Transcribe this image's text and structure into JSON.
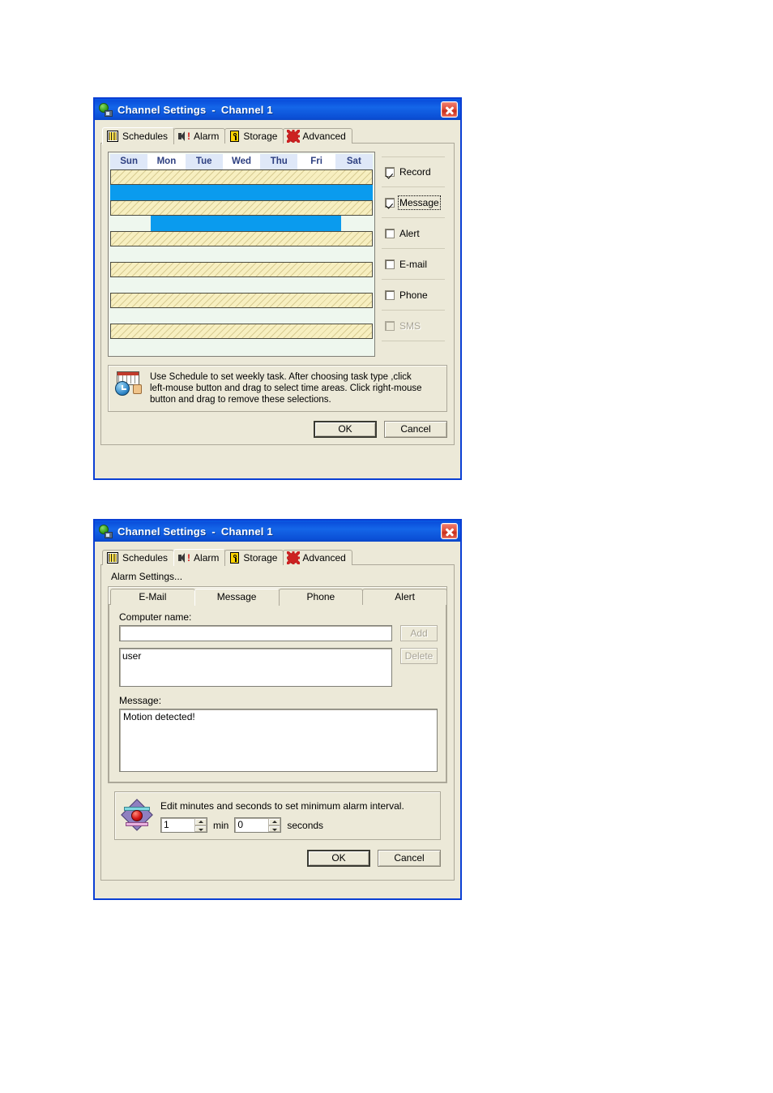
{
  "dialog1": {
    "title_app": "Channel Settings",
    "title_sep": "-",
    "title_channel": "Channel 1",
    "close_icon": "close-icon",
    "tabs": [
      {
        "label": "Schedules",
        "icon": "grid-icon",
        "active": true
      },
      {
        "label": "Alarm",
        "icon": "alarm-icon",
        "active": false
      },
      {
        "label": "Storage",
        "icon": "storage-icon",
        "active": false
      },
      {
        "label": "Advanced",
        "icon": "gear-icon",
        "active": false
      }
    ],
    "schedule": {
      "days": [
        "Sun",
        "Mon",
        "Tue",
        "Wed",
        "Thu",
        "Fri",
        "Sat"
      ],
      "rows": [
        {
          "type": "task",
          "selection": null
        },
        {
          "type": "empty",
          "selection": {
            "start_pct": 0,
            "width_pct": 100
          }
        },
        {
          "type": "task",
          "selection": null
        },
        {
          "type": "empty",
          "selection": {
            "start_pct": 15.5,
            "width_pct": 72.5
          }
        },
        {
          "type": "task",
          "selection": null
        },
        {
          "type": "empty",
          "selection": null
        },
        {
          "type": "task",
          "selection": null
        },
        {
          "type": "empty",
          "selection": null
        },
        {
          "type": "task",
          "selection": null
        },
        {
          "type": "empty",
          "selection": null
        },
        {
          "type": "task",
          "selection": null
        },
        {
          "type": "empty",
          "selection": null
        }
      ],
      "selection_color": "#0a9bee",
      "task_color": "#f7efc0",
      "empty_color": "#eef7ee"
    },
    "options": [
      {
        "label": "Record",
        "checked": true,
        "disabled": false,
        "focused": false
      },
      {
        "label": "Message",
        "checked": true,
        "disabled": false,
        "focused": true
      },
      {
        "label": "Alert",
        "checked": false,
        "disabled": false,
        "focused": false
      },
      {
        "label": "E-mail",
        "checked": false,
        "disabled": false,
        "focused": false
      },
      {
        "label": "Phone",
        "checked": false,
        "disabled": false,
        "focused": false
      },
      {
        "label": "SMS",
        "checked": false,
        "disabled": true,
        "focused": false
      }
    ],
    "hint": {
      "icon": "schedule-clock-icon",
      "line1": "Use Schedule to set weekly task. After choosing task type ,click",
      "line2": "left-mouse  button and drag to select time areas. Click right-mouse",
      "line3": "button and drag to remove these selections."
    },
    "buttons": {
      "ok": "OK",
      "cancel": "Cancel"
    }
  },
  "dialog2": {
    "title_app": "Channel Settings",
    "title_sep": "-",
    "title_channel": "Channel 1",
    "close_icon": "close-icon",
    "tabs": [
      {
        "label": "Schedules",
        "icon": "grid-icon",
        "active": false
      },
      {
        "label": "Alarm",
        "icon": "alarm-icon",
        "active": true
      },
      {
        "label": "Storage",
        "icon": "storage-icon",
        "active": false
      },
      {
        "label": "Advanced",
        "icon": "gear-icon",
        "active": false
      }
    ],
    "caption": "Alarm Settings...",
    "inner_tabs": [
      {
        "label": "E-Mail",
        "active": false
      },
      {
        "label": "Message",
        "active": true
      },
      {
        "label": "Phone",
        "active": false
      },
      {
        "label": "Alert",
        "active": false
      }
    ],
    "message_tab": {
      "computer_name_label": "Computer name:",
      "computer_name_value": "",
      "computer_name_placeholder": "",
      "add_label": "Add",
      "add_disabled": true,
      "delete_label": "Delete",
      "delete_disabled": true,
      "list_items": [
        "user"
      ],
      "message_label": "Message:",
      "message_value": "Motion detected!"
    },
    "interval": {
      "icon": "alarm-siren-icon",
      "text": "Edit minutes and seconds to set minimum alarm interval.",
      "minutes_value": "1",
      "minutes_unit": "min",
      "seconds_value": "0",
      "seconds_unit": "seconds"
    },
    "buttons": {
      "ok": "OK",
      "cancel": "Cancel"
    }
  }
}
